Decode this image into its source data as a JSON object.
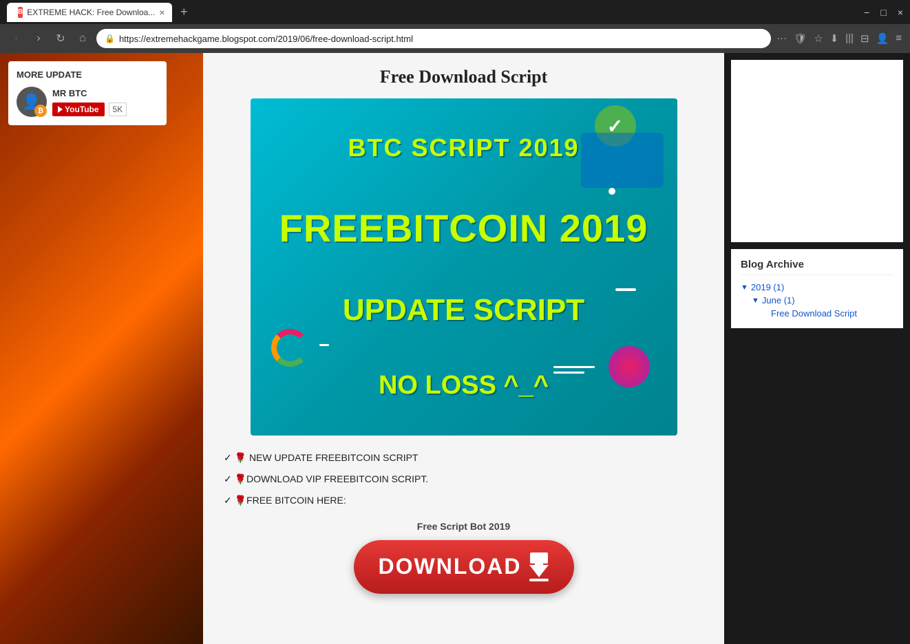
{
  "browser": {
    "tab_title": "EXTREME HACK: Free Downloa...",
    "favicon_letter": "B",
    "new_tab_label": "+",
    "url": "https://extremehackgame.blogspot.com/2019/06/free-download-script.html",
    "window_controls": [
      "−",
      "□",
      "×"
    ]
  },
  "nav": {
    "back": "‹",
    "forward": "›",
    "refresh": "↻",
    "home": "⌂",
    "more_options": "···",
    "bookmark": "☆",
    "shield": "🛡",
    "download_icon": "⬇",
    "sidebar_icon": "|||",
    "tabs_icon": "⊟",
    "profile_icon": "👤",
    "menu_icon": "≡"
  },
  "sidebar": {
    "title": "MORE UPDATE",
    "author_name": "MR BTC",
    "youtube_label": "YouTube",
    "subscriber_count": "5K"
  },
  "main": {
    "page_title": "Free Download Script",
    "banner": {
      "line1": "BTC SCRIPT 2019",
      "line2": "FREEBITCOIN 2019",
      "line3": "UPDATE  SCRIPT",
      "line4": "NO LOSS ^_^"
    },
    "body_lines": [
      "✓ 🌹 NEW UPDATE FREEBITCOIN SCRIPT",
      "✓ 🌹DOWNLOAD VIP FREEBITCOIN SCRIPT.",
      "✓ 🌹FREE BITCOIN HERE:"
    ],
    "free_script_label": "Free Script Bot 2019",
    "download_button": "DOWNLOAD"
  },
  "right_sidebar": {
    "blog_archive_title": "Blog Archive",
    "year": "2019 (1)",
    "month": "June (1)",
    "post_link": "Free Download Script"
  }
}
